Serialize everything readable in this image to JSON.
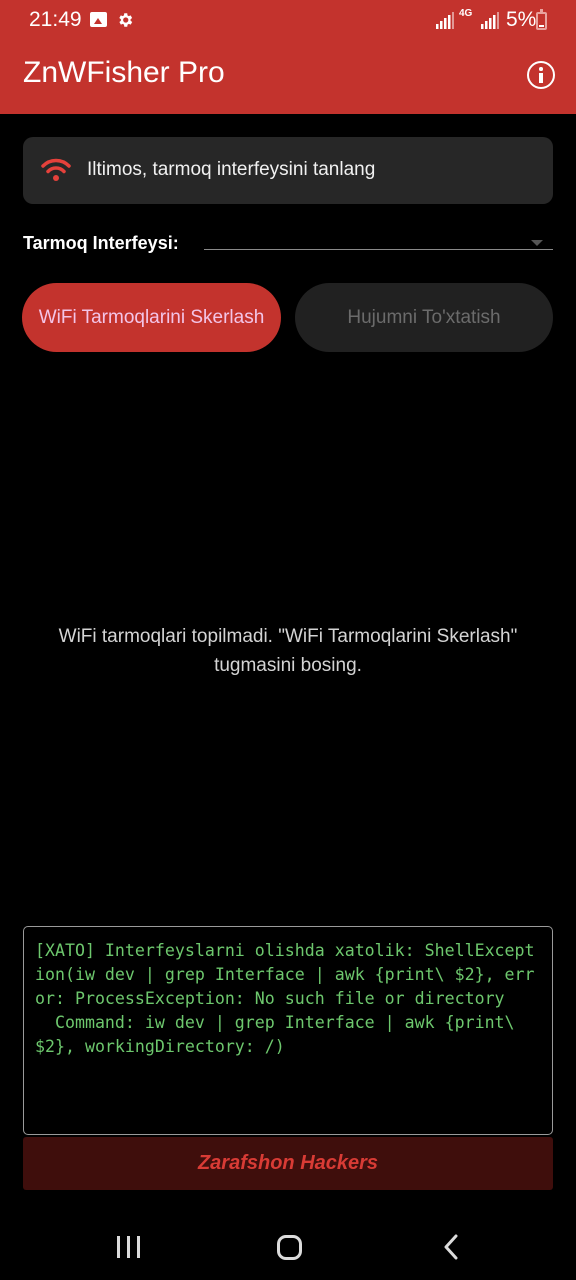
{
  "status_bar": {
    "time": "21:49",
    "network_type": "4G",
    "battery_percent": "5%"
  },
  "app_bar": {
    "title": "ZnWFisher Pro"
  },
  "notice_card": {
    "message": "Iltimos, tarmoq interfeysini tanlang",
    "icon": "wifi-icon",
    "icon_color": "#e5413b"
  },
  "interface_select": {
    "label": "Tarmoq Interfeysi:",
    "selected_value": ""
  },
  "buttons": {
    "scan_label": "WiFi Tarmoqlarini Skerlash",
    "stop_label": "Hujumni To'xtatish"
  },
  "empty_state": {
    "message": "WiFi tarmoqlari topilmadi. \"WiFi Tarmoqlarini Skerlash\" tugmasini bosing."
  },
  "log": {
    "text": "[XATO] Interfeyslarni olishda xatolik: ShellException(iw dev | grep Interface | awk {print\\ $2}, error: ProcessException: No such file or directory\n  Command: iw dev | grep Interface | awk {print\\ $2}, workingDirectory: /)"
  },
  "footer": {
    "text": "Zarafshon Hackers"
  },
  "colors": {
    "accent": "#c3332d",
    "log_text": "#6dc76d",
    "background": "#000000"
  }
}
